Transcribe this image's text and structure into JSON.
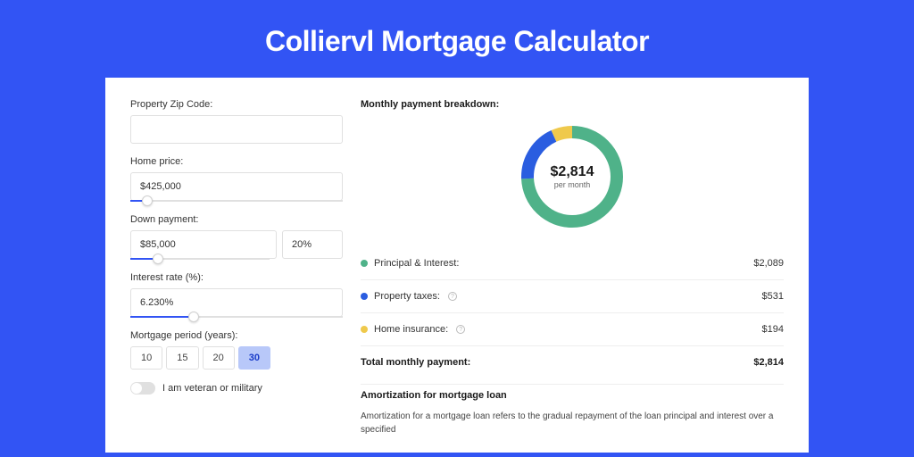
{
  "title": "Colliervl Mortgage Calculator",
  "form": {
    "zip_label": "Property Zip Code:",
    "zip_value": "",
    "home_price_label": "Home price:",
    "home_price_value": "$425,000",
    "home_price_slider_pct": 8,
    "down_payment_label": "Down payment:",
    "down_payment_value": "$85,000",
    "down_payment_pct_value": "20%",
    "down_payment_slider_pct": 20,
    "interest_label": "Interest rate (%):",
    "interest_value": "6.230%",
    "interest_slider_pct": 30,
    "period_label": "Mortgage period (years):",
    "periods": [
      "10",
      "15",
      "20",
      "30"
    ],
    "period_active_index": 3,
    "veteran_label": "I am veteran or military"
  },
  "breakdown": {
    "title": "Monthly payment breakdown:",
    "center_amount": "$2,814",
    "center_sub": "per month",
    "items": [
      {
        "label": "Principal & Interest:",
        "value": "$2,089",
        "color": "#4fb289",
        "info": false,
        "frac": 0.742
      },
      {
        "label": "Property taxes:",
        "value": "$531",
        "color": "#2a5de0",
        "info": true,
        "frac": 0.189
      },
      {
        "label": "Home insurance:",
        "value": "$194",
        "color": "#efc94c",
        "info": true,
        "frac": 0.069
      }
    ],
    "total_label": "Total monthly payment:",
    "total_value": "$2,814"
  },
  "amort": {
    "title": "Amortization for mortgage loan",
    "text": "Amortization for a mortgage loan refers to the gradual repayment of the loan principal and interest over a specified"
  },
  "chart_data": {
    "type": "pie",
    "title": "Monthly payment breakdown",
    "series": [
      {
        "name": "Principal & Interest",
        "value": 2089,
        "color": "#4fb289"
      },
      {
        "name": "Property taxes",
        "value": 531,
        "color": "#2a5de0"
      },
      {
        "name": "Home insurance",
        "value": 194,
        "color": "#efc94c"
      }
    ],
    "total": 2814,
    "unit": "USD per month"
  }
}
